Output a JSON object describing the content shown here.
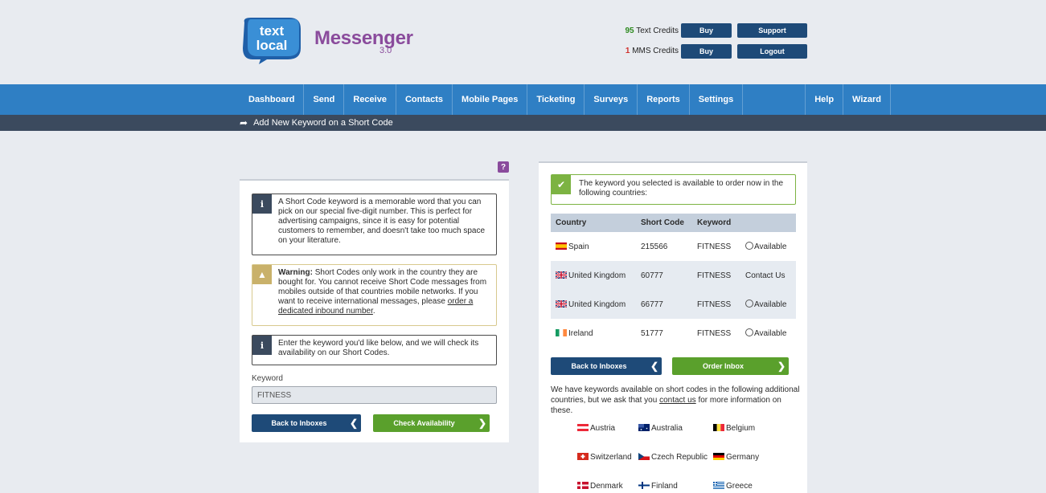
{
  "header": {
    "logo_line1": "text",
    "logo_line2": "local",
    "brand": "Messenger",
    "version": "3.0",
    "text_credits_count": "95",
    "text_credits_label": "Text Credits",
    "mms_credits_count": "1",
    "mms_credits_label": "MMS Credits",
    "buy_label": "Buy",
    "support_label": "Support",
    "logout_label": "Logout"
  },
  "nav": {
    "items": [
      "Dashboard",
      "Send",
      "Receive",
      "Contacts",
      "Mobile Pages",
      "Ticketing",
      "Surveys",
      "Reports",
      "Settings",
      "Help",
      "Wizard"
    ]
  },
  "subbar": {
    "title": "Add New Keyword on a Short Code"
  },
  "help_label": "?",
  "left": {
    "info1": "A Short Code keyword is a memorable word that you can pick on our special five-digit number. This is perfect for advertising campaigns, since it is easy for potential customers to remember, and doesn't take too much space on your literature.",
    "warning_bold": "Warning:",
    "warning_text": " Short Codes only work in the country they are bought for. You cannot receive Short Code messages from mobiles outside of that countries mobile networks. If you want to receive international messages, please ",
    "warning_link": "order a dedicated inbound number",
    "warning_end": ".",
    "info2": "Enter the keyword you'd like below, and we will check its availability on our Short Codes.",
    "keyword_label": "Keyword",
    "keyword_value": "FITNESS",
    "back_label": "Back to Inboxes",
    "check_label": "Check Availability"
  },
  "right": {
    "ok_text": "The keyword you selected is available to order now in the following countries:",
    "columns": [
      "Country",
      "Short Code",
      "Keyword"
    ],
    "rows": [
      {
        "country": "Spain",
        "code": "215566",
        "keyword": "FITNESS",
        "status": "Available"
      },
      {
        "country": "United Kingdom",
        "code": "60777",
        "keyword": "FITNESS",
        "status": "Contact Us"
      },
      {
        "country": "United Kingdom",
        "code": "66777",
        "keyword": "FITNESS",
        "status": "Available"
      },
      {
        "country": "Ireland",
        "code": "51777",
        "keyword": "FITNESS",
        "status": "Available"
      }
    ],
    "back_label": "Back to Inboxes",
    "order_label": "Order Inbox",
    "more_text": "We have keywords available on short codes in the following additional countries, but we ask that you ",
    "more_link": "contact us",
    "more_end": " for more information on these.",
    "countries": [
      "Austria",
      "Australia",
      "Belgium",
      "Switzerland",
      "Czech Republic",
      "Germany",
      "Denmark",
      "Finland",
      "Greece"
    ]
  },
  "colors": {
    "nav_blue": "#2f7fc4",
    "dark_blue": "#1e4a78",
    "green": "#5aa02c",
    "purple": "#8a4b9c"
  }
}
